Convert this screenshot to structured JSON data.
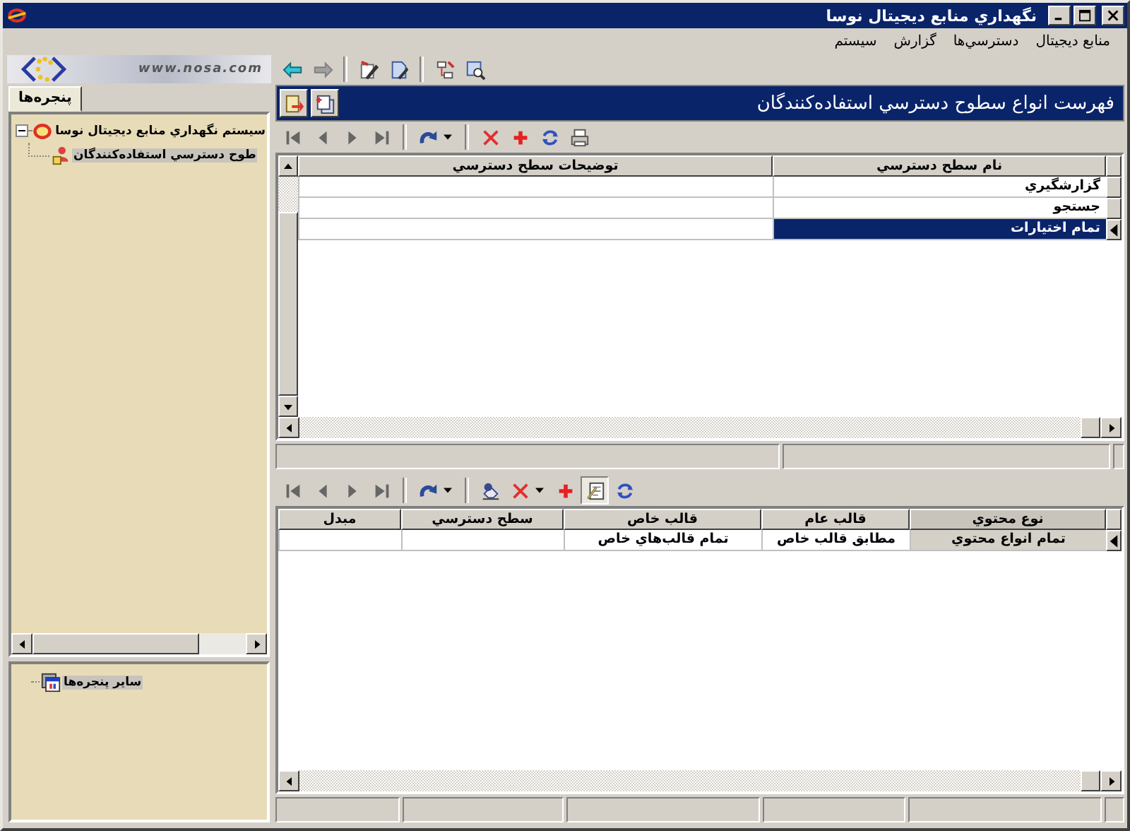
{
  "window": {
    "title": "نگهداري منابع ديجيتال نوسا"
  },
  "menu": [
    "منابع ديجيتال",
    "دسترسي‌ها",
    "گزارش",
    "سيستم"
  ],
  "logo": {
    "url": "www.nosa.com"
  },
  "sidebar": {
    "tabs": [
      {
        "label": "پنجره‌ها",
        "selected": true
      }
    ],
    "tree": [
      {
        "label": "سيستم نگهداري منابع ديجيتال نوسا",
        "expanded": true,
        "selected": false,
        "children": [
          {
            "label": "طوح دسترسي استفاده‌كنندگان",
            "selected": true
          }
        ]
      }
    ],
    "other_windows": [
      {
        "label": "ساير پنجره‌ها",
        "selected": true
      }
    ]
  },
  "form": {
    "title": "فهرست انواع سطوح دسترسي استفاده‌كنندگان",
    "table": {
      "columns": [
        "نام سطح دسترسي",
        "توضيحات سطح دسترسي"
      ],
      "rows": [
        {
          "name": "گزارشگيري",
          "selected": false
        },
        {
          "name": "جستجو",
          "selected": false
        },
        {
          "name": "تمام اختيارات",
          "selected": true
        }
      ]
    },
    "detail_toolbar": {
      "notes_toggle": {
        "on": true
      }
    },
    "detail_table": {
      "columns": [
        "نوع محتوي",
        "قالب عام",
        "قالب خاص",
        "سطح دسترسي",
        "مبدل"
      ],
      "rows": [
        {
          "cells": [
            "تمام انواع محتوي",
            "مطابق قالب خاص",
            "تمام قالب‌هاي خاص"
          ],
          "selected": true
        }
      ]
    }
  }
}
